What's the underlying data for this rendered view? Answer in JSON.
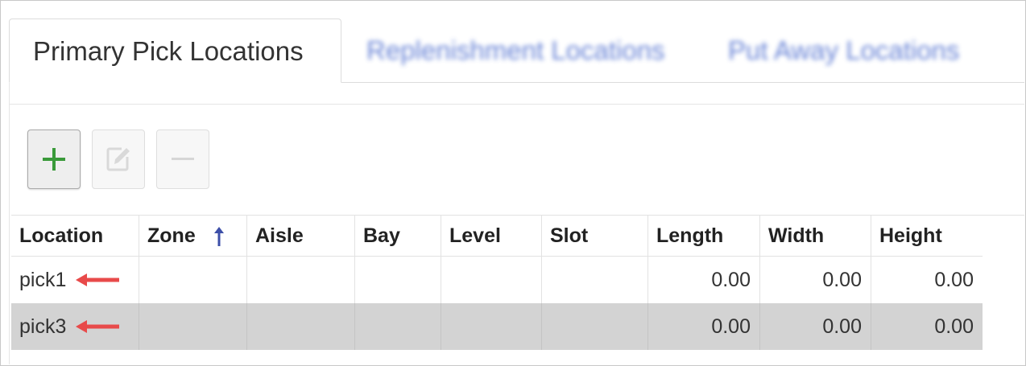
{
  "tabs": [
    {
      "label": "Primary Pick Locations",
      "active": true
    },
    {
      "label": "Replenishment Locations",
      "active": false
    },
    {
      "label": "Put Away Locations",
      "active": false
    }
  ],
  "toolbar": {
    "add": {
      "icon": "plus-icon",
      "enabled": true,
      "color": "#3a9a3a"
    },
    "edit": {
      "icon": "edit-icon",
      "enabled": false
    },
    "remove": {
      "icon": "minus-icon",
      "enabled": false
    }
  },
  "grid": {
    "columns": [
      "Location",
      "Zone",
      "Aisle",
      "Bay",
      "Level",
      "Slot",
      "Length",
      "Width",
      "Height"
    ],
    "sorted_column": "Zone",
    "sort_direction": "ascending",
    "sort_icon_color": "#3d4fa8",
    "rows": [
      {
        "location": "pick1",
        "zone": "",
        "aisle": "",
        "bay": "",
        "level": "",
        "slot": "",
        "length": "0.00",
        "width": "0.00",
        "height": "0.00",
        "selected": false
      },
      {
        "location": "pick3",
        "zone": "",
        "aisle": "",
        "bay": "",
        "level": "",
        "slot": "",
        "length": "0.00",
        "width": "0.00",
        "height": "0.00",
        "selected": true
      }
    ]
  },
  "annotation": {
    "arrow_color": "#e84a4a",
    "arrow_icon": "red-left-arrow-icon"
  },
  "colors": {
    "selected_row": "#d3d3d3",
    "blurred_tab": "#4f6fcf"
  }
}
